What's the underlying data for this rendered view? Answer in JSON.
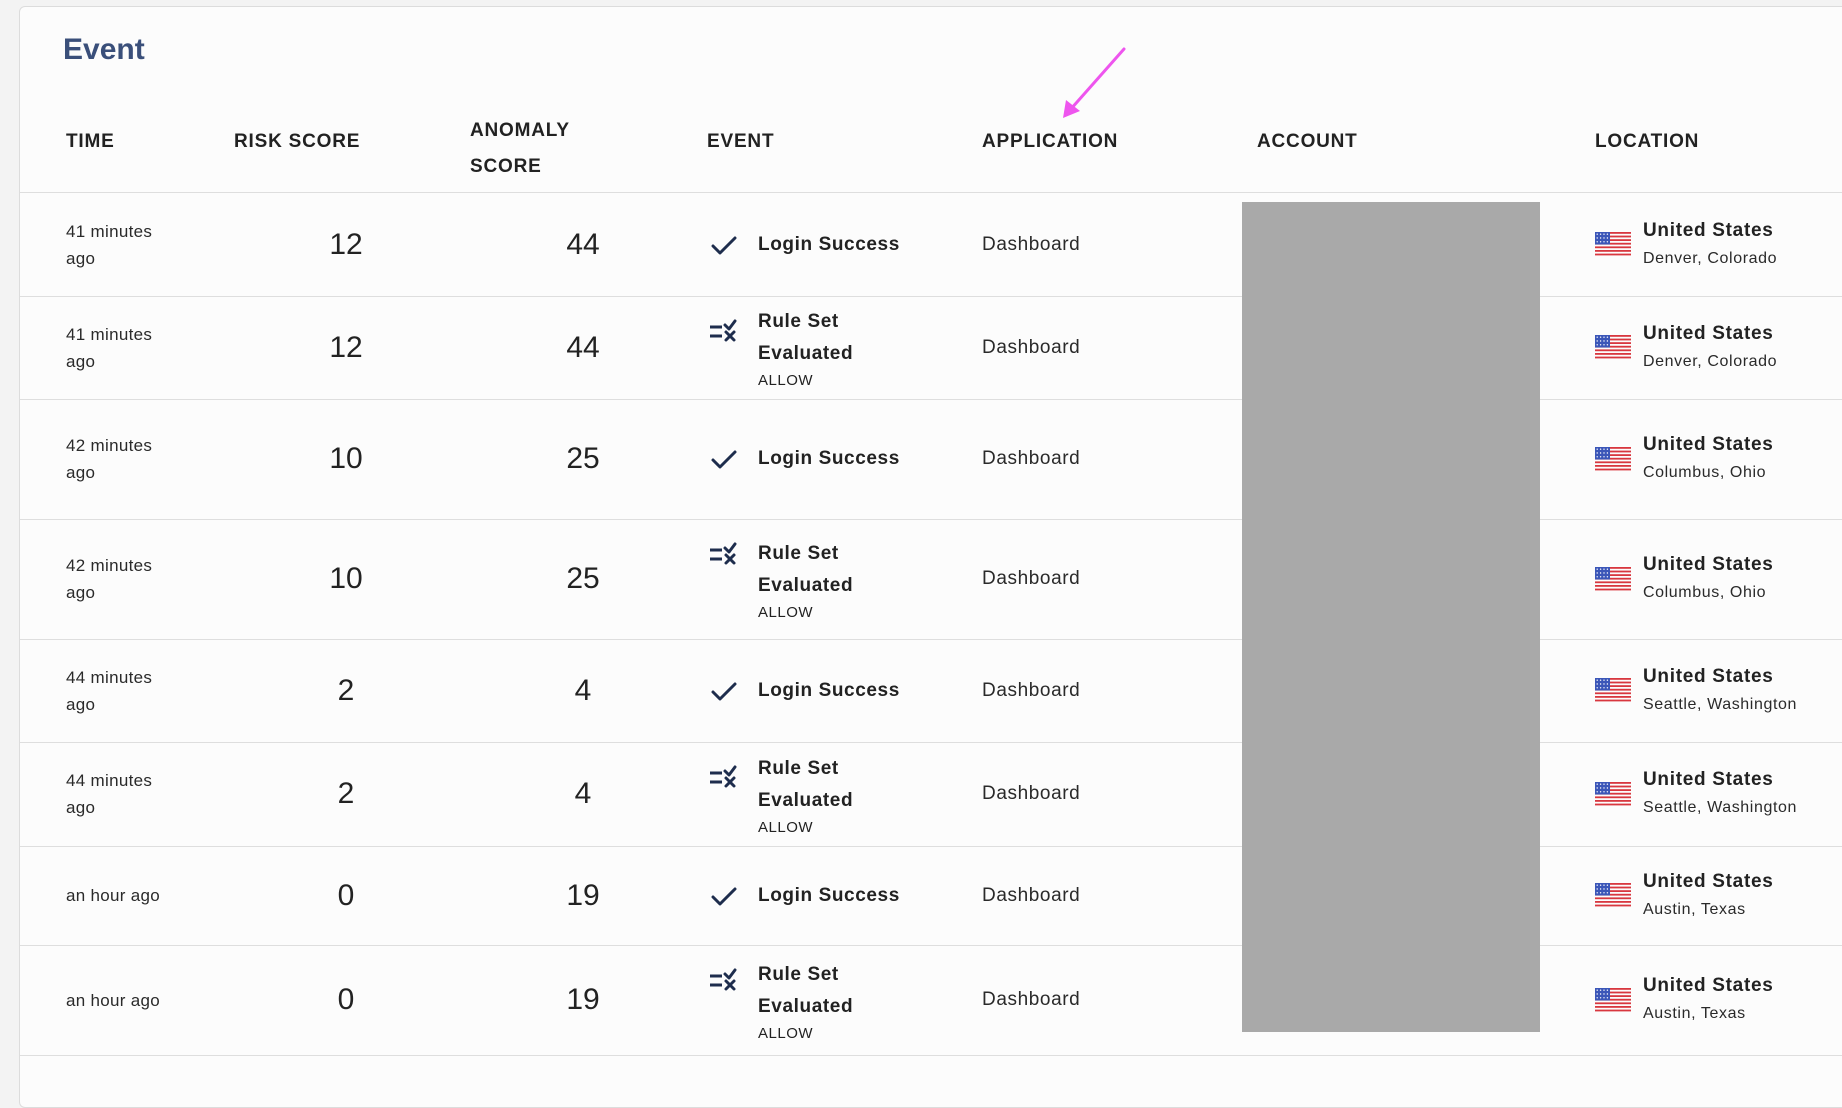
{
  "panel": {
    "title": "Event"
  },
  "columns": {
    "time": "TIME",
    "risk_score": "RISK SCORE",
    "anomaly_score_line1": "ANOMALY",
    "anomaly_score_line2": "SCORE",
    "event": "EVENT",
    "application": "APPLICATION",
    "account": "ACCOUNT",
    "location": "LOCATION"
  },
  "colors": {
    "title": "#3a4f7a",
    "icon": "#1e2d4d",
    "annotation_arrow": "#ee55ee",
    "redaction": "#a9a9a9"
  },
  "rows": [
    {
      "time": "41 minutes ago",
      "risk": "12",
      "anomaly": "44",
      "event_icon": "check-icon",
      "event": "Login Success",
      "event_sub": "",
      "application": "Dashboard",
      "account": "",
      "country": "United States",
      "city": "Denver, Colorado",
      "flag": "us-flag-icon"
    },
    {
      "time": "41 minutes ago",
      "risk": "12",
      "anomaly": "44",
      "event_icon": "rule-set-icon",
      "event": "Rule Set Evaluated",
      "event_sub": "ALLOW",
      "application": "Dashboard",
      "account": "",
      "country": "United States",
      "city": "Denver, Colorado",
      "flag": "us-flag-icon"
    },
    {
      "time": "42 minutes ago",
      "risk": "10",
      "anomaly": "25",
      "event_icon": "check-icon",
      "event": "Login Success",
      "event_sub": "",
      "application": "Dashboard",
      "account": "",
      "country": "United States",
      "city": "Columbus, Ohio",
      "flag": "us-flag-icon"
    },
    {
      "time": "42 minutes ago",
      "risk": "10",
      "anomaly": "25",
      "event_icon": "rule-set-icon",
      "event": "Rule Set Evaluated",
      "event_sub": "ALLOW",
      "application": "Dashboard",
      "account": "",
      "country": "United States",
      "city": "Columbus, Ohio",
      "flag": "us-flag-icon"
    },
    {
      "time": "44 minutes ago",
      "risk": "2",
      "anomaly": "4",
      "event_icon": "check-icon",
      "event": "Login Success",
      "event_sub": "",
      "application": "Dashboard",
      "account": "",
      "country": "United States",
      "city": "Seattle, Washington",
      "flag": "us-flag-icon"
    },
    {
      "time": "44 minutes ago",
      "risk": "2",
      "anomaly": "4",
      "event_icon": "rule-set-icon",
      "event": "Rule Set Evaluated",
      "event_sub": "ALLOW",
      "application": "Dashboard",
      "account": "",
      "country": "United States",
      "city": "Seattle, Washington",
      "flag": "us-flag-icon"
    },
    {
      "time": "an hour ago",
      "risk": "0",
      "anomaly": "19",
      "event_icon": "check-icon",
      "event": "Login Success",
      "event_sub": "",
      "application": "Dashboard",
      "account": "",
      "country": "United States",
      "city": "Austin, Texas",
      "flag": "us-flag-icon"
    },
    {
      "time": "an hour ago",
      "risk": "0",
      "anomaly": "19",
      "event_icon": "rule-set-icon",
      "event": "Rule Set Evaluated",
      "event_sub": "ALLOW",
      "application": "Dashboard",
      "account": "",
      "country": "United States",
      "city": "Austin, Texas",
      "flag": "us-flag-icon"
    }
  ]
}
